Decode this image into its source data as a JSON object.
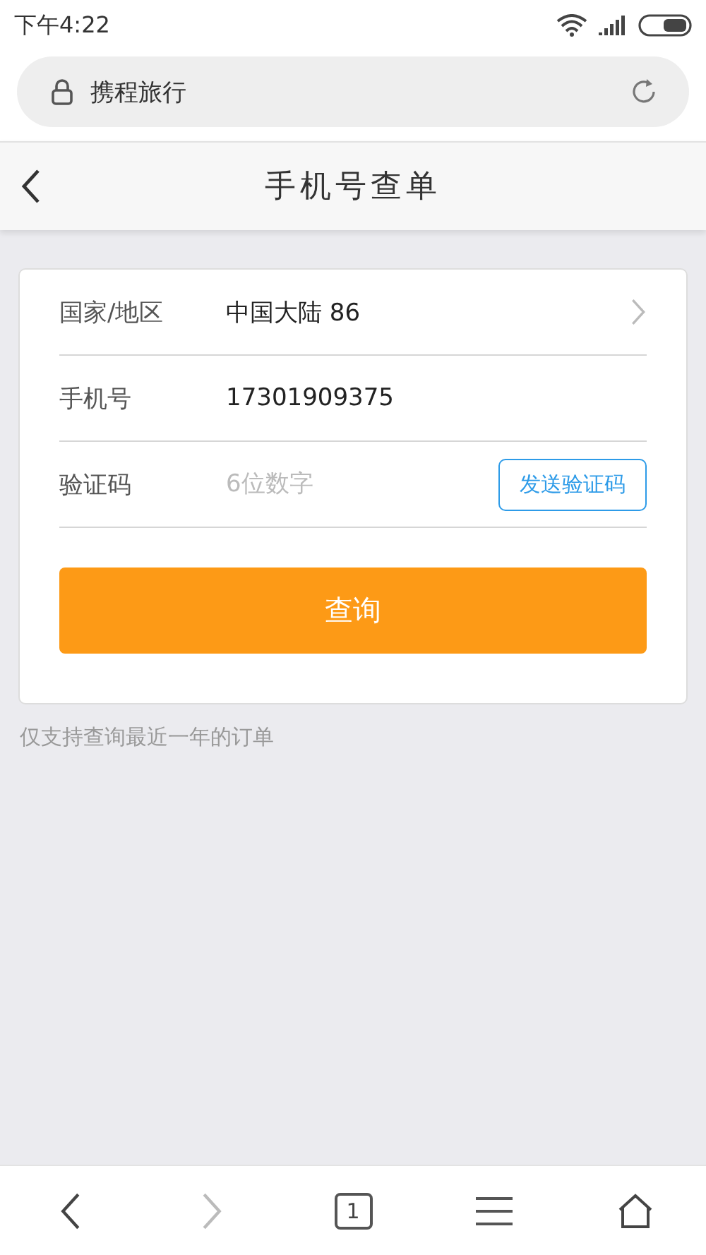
{
  "status_bar": {
    "time": "下午4:22"
  },
  "address_bar": {
    "site": "携程旅行"
  },
  "header": {
    "title": "手机号查单"
  },
  "form": {
    "rows": [
      {
        "kind": "select",
        "label": "国家/地区",
        "value": "中国大陆 86"
      },
      {
        "kind": "input",
        "label": "手机号",
        "value": "17301909375"
      },
      {
        "kind": "code",
        "label": "验证码",
        "placeholder": "6位数字",
        "button": "发送验证码"
      }
    ],
    "submit": "查询"
  },
  "note": "仅支持查询最近一年的订单",
  "bottom_nav": {
    "back_disabled": false,
    "forward_disabled": true,
    "tab_count": "1"
  }
}
